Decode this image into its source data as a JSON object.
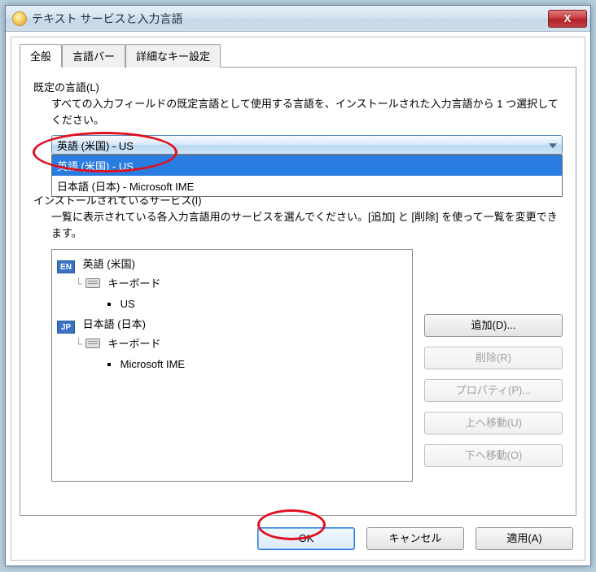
{
  "window": {
    "title": "テキスト サービスと入力言語",
    "close_glyph": "X"
  },
  "tabs": [
    "全般",
    "言語バー",
    "詳細なキー設定"
  ],
  "default_lang": {
    "label": "既定の言語(L)",
    "desc": "すべての入力フィールドの既定言語として使用する言語を、インストールされた入力言語から 1 つ選択してください。",
    "selected": "英語 (米国) - US",
    "options": [
      "英語 (米国) - US",
      "日本語 (日本) - Microsoft IME"
    ]
  },
  "services": {
    "label": "インストールされているサービス(I)",
    "desc": "一覧に表示されている各入力言語用のサービスを選んでください。[追加] と [削除] を使って一覧を変更できます。",
    "tree": [
      {
        "badge": "EN",
        "lang": "英語 (米国)",
        "kb_label": "キーボード",
        "layouts": [
          "US"
        ]
      },
      {
        "badge": "JP",
        "lang": "日本語 (日本)",
        "kb_label": "キーボード",
        "layouts": [
          "Microsoft IME"
        ]
      }
    ],
    "buttons": {
      "add": "追加(D)...",
      "remove": "削除(R)",
      "props": "プロパティ(P)...",
      "up": "上へ移動(U)",
      "down": "下へ移動(O)"
    }
  },
  "footer": {
    "ok": "OK",
    "cancel": "キャンセル",
    "apply": "適用(A)"
  }
}
